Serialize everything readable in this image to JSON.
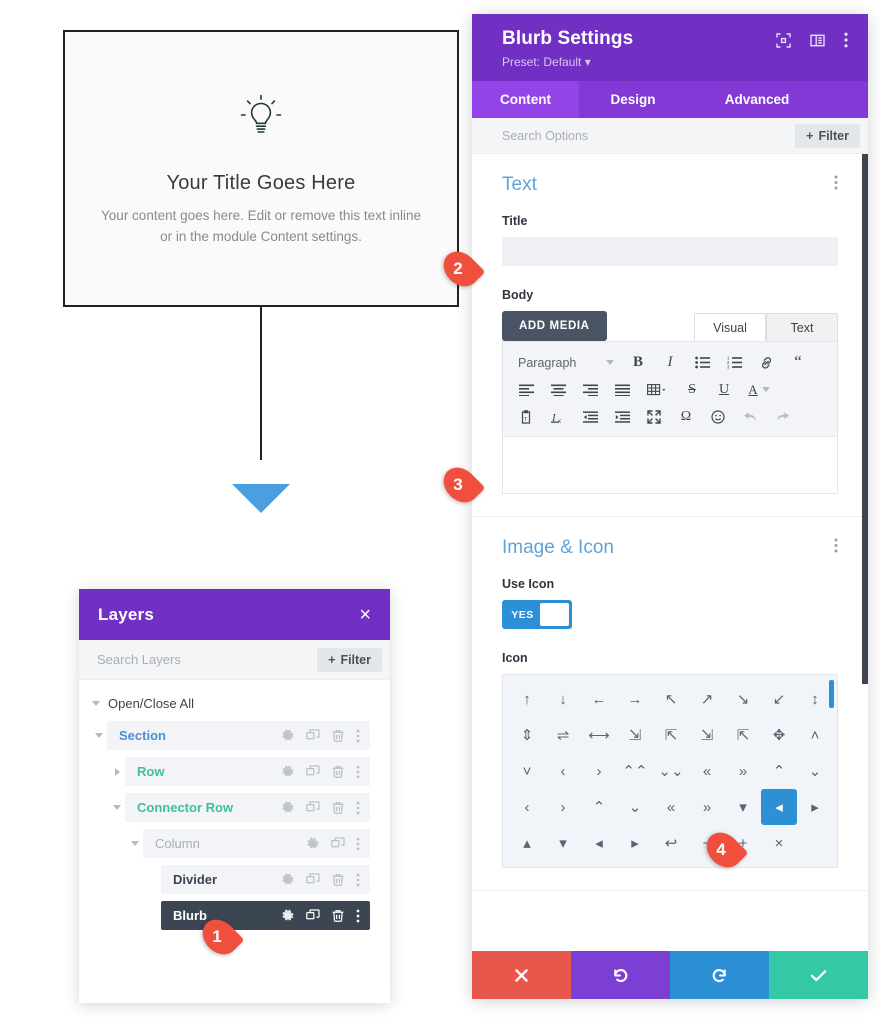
{
  "canvas": {
    "card": {
      "icon": "lightbulb-icon",
      "title": "Your Title Goes Here",
      "body": "Your content goes here. Edit or remove this text inline or in the module Content settings."
    },
    "connector": {
      "arrow_color": "#4a9fe0"
    }
  },
  "layers_panel": {
    "title": "Layers",
    "close_icon": "×",
    "search_placeholder": "Search Layers",
    "filter_label": "Filter",
    "open_close_all": "Open/Close All",
    "rows": [
      {
        "label": "Section",
        "indent": 0,
        "caret": "down",
        "color": "blue",
        "selected": false,
        "actions": [
          "gear",
          "duplicate",
          "trash",
          "kebab"
        ]
      },
      {
        "label": "Row",
        "indent": 1,
        "caret": "right",
        "color": "green",
        "selected": false,
        "actions": [
          "gear",
          "duplicate",
          "trash",
          "kebab"
        ]
      },
      {
        "label": "Connector Row",
        "indent": 1,
        "caret": "down",
        "color": "green",
        "selected": false,
        "actions": [
          "gear",
          "duplicate",
          "trash",
          "kebab"
        ]
      },
      {
        "label": "Column",
        "indent": 2,
        "caret": "down",
        "color": "gray",
        "selected": false,
        "actions": [
          "gear",
          "duplicate",
          "kebab"
        ]
      },
      {
        "label": "Divider",
        "indent": 3,
        "caret": "none",
        "color": "dark",
        "selected": false,
        "actions": [
          "gear",
          "duplicate",
          "trash",
          "kebab"
        ]
      },
      {
        "label": "Blurb",
        "indent": 3,
        "caret": "none",
        "color": "white",
        "selected": true,
        "actions": [
          "gear",
          "duplicate",
          "trash",
          "kebab"
        ]
      }
    ]
  },
  "settings": {
    "title": "Blurb Settings",
    "preset": "Preset: Default",
    "header_icons": [
      "expand-icon",
      "panel-layout-icon",
      "kebab-icon"
    ],
    "tabs": [
      {
        "label": "Content",
        "active": true
      },
      {
        "label": "Design",
        "active": false
      },
      {
        "label": "Advanced",
        "active": false
      }
    ],
    "search_placeholder": "Search Options",
    "filter_label": "Filter",
    "text_section": {
      "heading": "Text",
      "title_label": "Title",
      "title_value": "",
      "body_label": "Body",
      "add_media_label": "ADD MEDIA",
      "editor_tabs": [
        {
          "label": "Visual",
          "active": true
        },
        {
          "label": "Text",
          "active": false
        }
      ],
      "format_select": "Paragraph",
      "toolbar_row1": [
        "bold-icon",
        "italic-icon",
        "bulleted-list-icon",
        "numbered-list-icon",
        "link-icon",
        "blockquote-icon"
      ],
      "toolbar_row2": [
        "align-left-icon",
        "align-center-icon",
        "align-right-icon",
        "align-justify-icon",
        "table-icon",
        "strikethrough-icon",
        "underline-icon",
        "text-color-icon"
      ],
      "toolbar_row3": [
        "paste-as-text-icon",
        "clear-formatting-icon",
        "outdent-icon",
        "indent-icon",
        "fullscreen-icon",
        "special-character-icon",
        "emoji-icon",
        "undo-icon",
        "redo-icon"
      ],
      "body_value": ""
    },
    "image_icon_section": {
      "heading": "Image & Icon",
      "use_icon_label": "Use Icon",
      "toggle_value": "YES",
      "icon_label": "Icon",
      "selected_index": 34,
      "glyphs": [
        "↑",
        "↓",
        "←",
        "→",
        "↖",
        "↗",
        "↘",
        "↙",
        "↕",
        "⇕",
        "⇌",
        "⟷",
        "⇲",
        "⇱",
        "⇲",
        "⇱",
        "✥",
        "˄",
        "˅",
        "‹",
        "›",
        "⌃⌃",
        "⌄⌄",
        "«",
        "»",
        "⌃",
        "⌄",
        "‹",
        "›",
        "⌃",
        "⌄",
        "«",
        "»",
        "▾",
        "◂",
        "▸",
        "▴",
        "▾",
        "◂",
        "▸",
        "↩",
        "−",
        "+",
        "×"
      ]
    },
    "footer": [
      {
        "name": "cancel-button",
        "icon": "×",
        "color": "#e8574b"
      },
      {
        "name": "undo-button",
        "icon": "↺",
        "color": "#7b3fd4"
      },
      {
        "name": "redo-button",
        "icon": "↻",
        "color": "#2d8fd5"
      },
      {
        "name": "save-button",
        "icon": "✓",
        "color": "#33c9a6"
      }
    ]
  },
  "markers": [
    {
      "number": "1"
    },
    {
      "number": "2"
    },
    {
      "number": "3"
    },
    {
      "number": "4"
    }
  ]
}
